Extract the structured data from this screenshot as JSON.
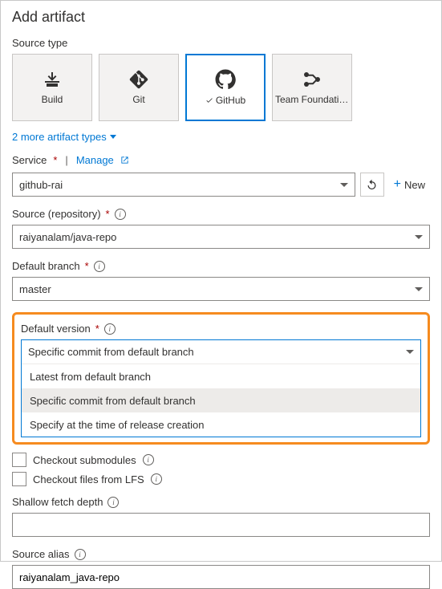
{
  "title": "Add artifact",
  "source_type_label": "Source type",
  "tiles": {
    "build": "Build",
    "git": "Git",
    "github": "GitHub",
    "tfvc": "Team Foundation..."
  },
  "more_types": "2 more artifact types",
  "service": {
    "label": "Service",
    "manage": "Manage",
    "value": "github-rai",
    "new": "New"
  },
  "repo": {
    "label": "Source (repository)",
    "value": "raiyanalam/java-repo"
  },
  "branch": {
    "label": "Default branch",
    "value": "master"
  },
  "version": {
    "label": "Default version",
    "value": "Specific commit from default branch",
    "options": [
      "Latest from default branch",
      "Specific commit from default branch",
      "Specify at the time of release creation"
    ]
  },
  "checkouts": {
    "submodules": "Checkout submodules",
    "lfs": "Checkout files from LFS"
  },
  "fetch_depth_label": "Shallow fetch depth",
  "alias": {
    "label": "Source alias",
    "value": "raiyanalam_java-repo"
  }
}
